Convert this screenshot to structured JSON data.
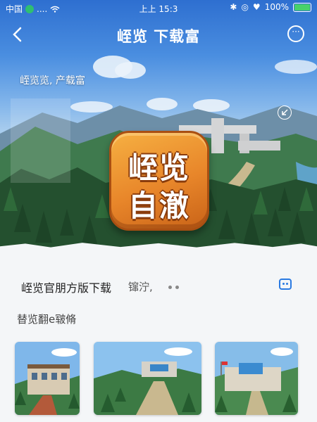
{
  "status_bar": {
    "carrier": "中国",
    "time": "上上 15:3",
    "battery": "100%",
    "battery_level": 1.0
  },
  "nav": {
    "title": "峌览 下载富"
  },
  "hero": {
    "caption": "峌览览, 产载富",
    "badge_line1": "峌览",
    "badge_line2": "自澈"
  },
  "info": {
    "title": "峌览官朋方版下载",
    "subtitle": "镩泞,"
  },
  "section": {
    "title": "替览翻e皲脩"
  },
  "colors": {
    "accent": "#2a7ae2",
    "badge": "#e8862a"
  }
}
